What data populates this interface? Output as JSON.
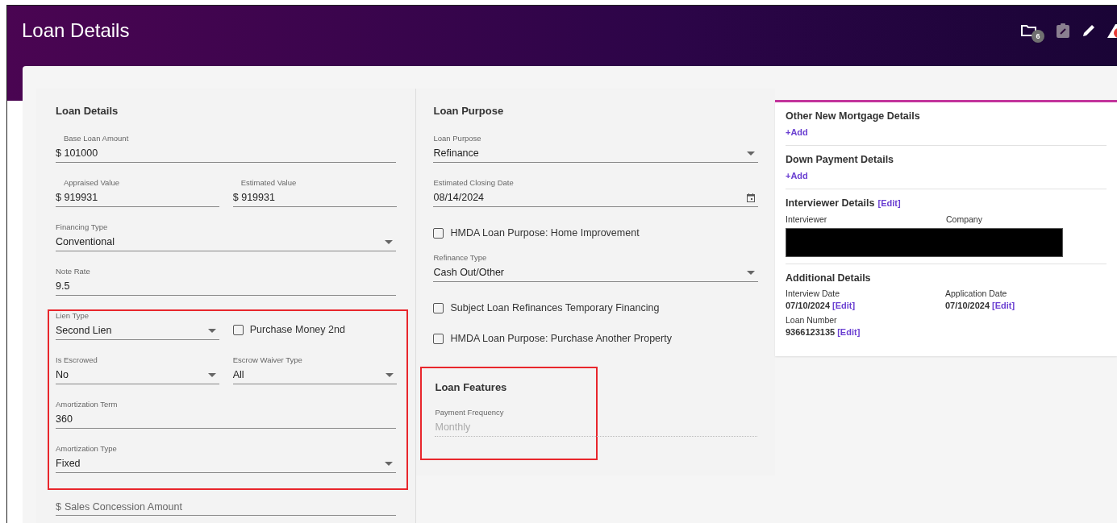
{
  "header": {
    "title": "Loan Details",
    "icons": [
      {
        "kind": "folder",
        "badge": "6",
        "disabled": false
      },
      {
        "kind": "clipboard",
        "disabled": true
      },
      {
        "kind": "pencil",
        "disabled": false
      },
      {
        "kind": "warning",
        "disabled": false
      }
    ]
  },
  "loan_details": {
    "title": "Loan Details",
    "groups": [
      {
        "highlighted": false,
        "rows": [
          [
            {
              "kind": "text",
              "label": "Base Loan Amount",
              "value": "$ 101000",
              "inset": true
            }
          ],
          [
            {
              "kind": "text",
              "label": "Appraised Value",
              "value": "$ 919931",
              "inset": true
            },
            {
              "kind": "text",
              "label": "Estimated Value",
              "value": "$ 919931",
              "inset": true
            }
          ],
          [
            {
              "kind": "select",
              "label": "Financing Type",
              "value": "Conventional"
            }
          ],
          [
            {
              "kind": "text",
              "label": "Note Rate",
              "value": "9.5"
            }
          ]
        ]
      },
      {
        "highlighted": true,
        "rows": [
          [
            {
              "kind": "select",
              "label": "Lien Type",
              "value": "Second Lien"
            },
            {
              "kind": "checkbox",
              "label": "Purchase Money 2nd",
              "checked": false
            }
          ],
          [
            {
              "kind": "select",
              "label": "Is Escrowed",
              "value": "No"
            },
            {
              "kind": "select",
              "label": "Escrow Waiver Type",
              "value": "All"
            }
          ],
          [
            {
              "kind": "text",
              "label": "Amortization Term",
              "value": "360"
            }
          ],
          [
            {
              "kind": "select",
              "label": "Amortization Type",
              "value": "Fixed"
            }
          ]
        ]
      },
      {
        "highlighted": false,
        "rows": [
          [
            {
              "kind": "empty",
              "prefix": "$",
              "placeholder": "Sales Concession Amount"
            }
          ]
        ]
      }
    ]
  },
  "loan_purpose": {
    "title": "Loan Purpose",
    "items": [
      {
        "kind": "select",
        "label": "Loan Purpose",
        "value": "Refinance"
      },
      {
        "kind": "date",
        "label": "Estimated Closing Date",
        "value": "08/14/2024"
      },
      {
        "kind": "checkbox",
        "label": "HMDA Loan Purpose: Home Improvement",
        "checked": false
      },
      {
        "kind": "select",
        "label": "Refinance Type",
        "value": "Cash Out/Other"
      },
      {
        "kind": "checkbox",
        "label": "Subject Loan Refinances Temporary Financing",
        "checked": false
      },
      {
        "kind": "checkbox",
        "label": "HMDA Loan Purpose: Purchase Another Property",
        "checked": false
      }
    ]
  },
  "loan_features": {
    "title": "Loan Features",
    "highlighted": true,
    "items": [
      {
        "kind": "readonly",
        "label": "Payment Frequency",
        "value": "Monthly"
      }
    ]
  },
  "side_card": {
    "sections": [
      {
        "kind": "add",
        "title": "Other New Mortgage Details",
        "link": "+Add"
      },
      {
        "kind": "add",
        "title": "Down Payment Details",
        "link": "+Add"
      },
      {
        "kind": "people",
        "title": "Interviewer Details",
        "edit": "[Edit]",
        "columns": [
          "Interviewer",
          "Company"
        ]
      },
      {
        "kind": "facts",
        "title": "Additional Details",
        "facts": [
          {
            "label": "Interview Date",
            "value": "07/10/2024",
            "edit": "[Edit]"
          },
          {
            "label": "Application Date",
            "value": "07/10/2024",
            "edit": "[Edit]"
          },
          {
            "label": "Loan Number",
            "value": "9366123135",
            "edit": "[Edit]"
          }
        ]
      }
    ]
  }
}
